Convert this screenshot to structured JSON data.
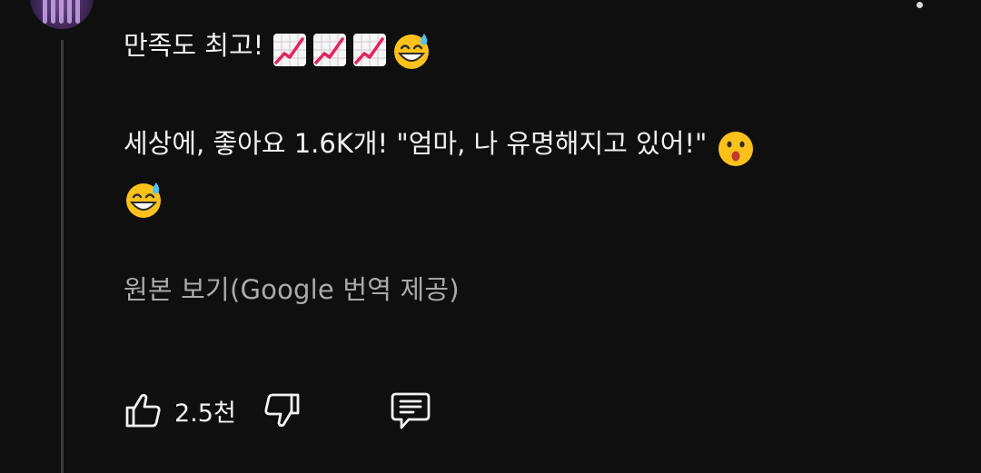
{
  "comment": {
    "line1_text": "만족도 최고!",
    "line1_emojis": [
      "chart-increasing-emoji",
      "chart-increasing-emoji",
      "chart-increasing-emoji",
      "grinning-sweat-emoji"
    ],
    "line2_text": "세상에, 좋아요 1.6K개! \"엄마, 나 유명해지고 있어!\"",
    "line2_emojis": [
      "hushed-face-emoji",
      "grinning-sweat-emoji"
    ]
  },
  "translate_link": "원본 보기(Google 번역 제공)",
  "actions": {
    "like_count": "2.5천",
    "icons": [
      "thumbs-up-icon",
      "thumbs-down-icon",
      "reply-icon"
    ]
  },
  "colors": {
    "background": "#0f0f0f",
    "text": "#f1f1f1",
    "secondary_text": "#aaaaaa",
    "thread_line": "#3a3a3a"
  }
}
